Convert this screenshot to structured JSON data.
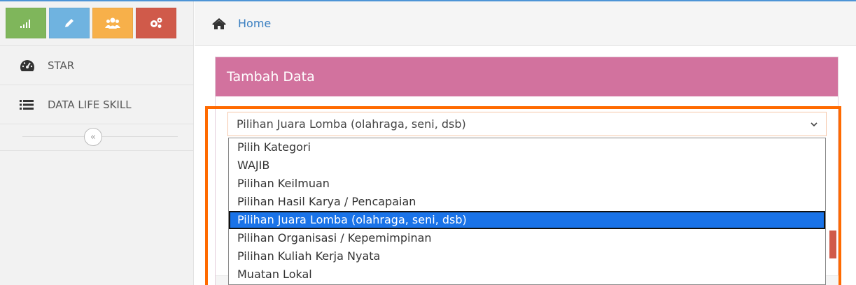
{
  "colors": {
    "accent_blue": "#4d94d6",
    "shortcut_green": "#7fb65b",
    "shortcut_blue": "#6fb3e0",
    "shortcut_orange": "#f7b04a",
    "shortcut_red": "#d05a4a",
    "panel_header": "#d2729e",
    "highlight": "#ff6a00",
    "option_selected": "#1a73e8"
  },
  "sidebar": {
    "shortcuts": [
      {
        "icon": "signal-icon",
        "color": "#7fb65b"
      },
      {
        "icon": "pencil-icon",
        "color": "#6fb3e0"
      },
      {
        "icon": "users-icon",
        "color": "#f7b04a"
      },
      {
        "icon": "cogs-icon",
        "color": "#d05a4a"
      }
    ],
    "items": [
      {
        "label": "STAR",
        "icon": "dashboard-icon"
      },
      {
        "label": "DATA LIFE SKILL",
        "icon": "list-icon"
      }
    ],
    "collapse_icon": "double-chevron-left-icon"
  },
  "breadcrumb": {
    "home_icon": "home-icon",
    "home_label": "Home"
  },
  "panel": {
    "title": "Tambah Data",
    "select": {
      "value": "Pilihan Juara Lomba (olahraga, seni, dsb)",
      "options": [
        "Pilih Kategori",
        "WAJIB",
        "Pilihan Keilmuan",
        "Pilihan Hasil Karya / Pencapaian",
        "Pilihan Juara Lomba (olahraga, seni, dsb)",
        "Pilihan Organisasi / Kepemimpinan",
        "Pilihan Kuliah Kerja Nyata",
        "Muatan Lokal"
      ],
      "selected_index": 4
    }
  }
}
